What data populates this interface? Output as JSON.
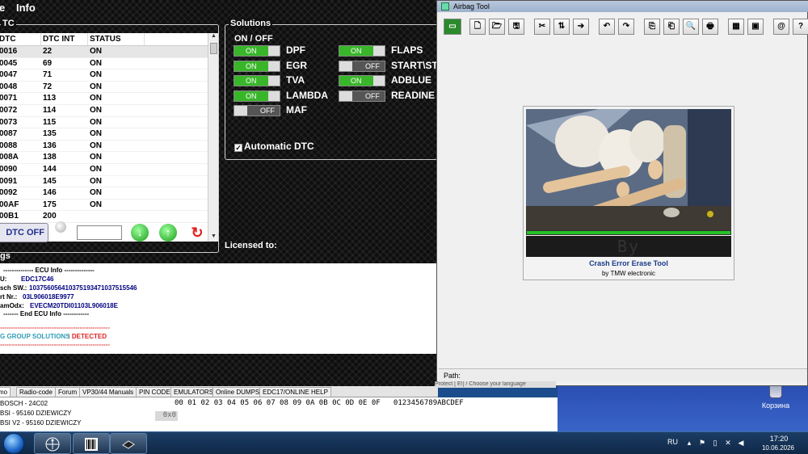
{
  "left_app": {
    "menu": [
      "e",
      "Info"
    ],
    "dtc": {
      "group_title": "TC",
      "headers": [
        "DTC",
        "DTC INT",
        "STATUS"
      ],
      "rows": [
        [
          "0016",
          "22",
          "ON"
        ],
        [
          "0045",
          "69",
          "ON"
        ],
        [
          "0047",
          "71",
          "ON"
        ],
        [
          "0048",
          "72",
          "ON"
        ],
        [
          "0071",
          "113",
          "ON"
        ],
        [
          "0072",
          "114",
          "ON"
        ],
        [
          "0073",
          "115",
          "ON"
        ],
        [
          "0087",
          "135",
          "ON"
        ],
        [
          "0088",
          "136",
          "ON"
        ],
        [
          "008A",
          "138",
          "ON"
        ],
        [
          "0090",
          "144",
          "ON"
        ],
        [
          "0091",
          "145",
          "ON"
        ],
        [
          "0092",
          "146",
          "ON"
        ],
        [
          "00AF",
          "175",
          "ON"
        ],
        [
          "00B1",
          "200",
          ""
        ]
      ]
    },
    "dtc_off_label": "DTC OFF",
    "dtc_input_value": "",
    "solutions": {
      "title": "Solutions",
      "on_off_header": "ON  /  OFF",
      "left": [
        {
          "label": "DPF",
          "state": "ON"
        },
        {
          "label": "EGR",
          "state": "ON"
        },
        {
          "label": "TVA",
          "state": "ON"
        },
        {
          "label": "LAMBDA",
          "state": "ON"
        },
        {
          "label": "MAF",
          "state": "OFF"
        }
      ],
      "right": [
        {
          "label": "FLAPS",
          "state": "ON"
        },
        {
          "label": "START\\ST",
          "state": "OFF"
        },
        {
          "label": "ADBLUE",
          "state": "ON"
        },
        {
          "label": "READINE",
          "state": "OFF"
        }
      ],
      "auto_dtc": "Automatic DTC"
    },
    "licensed_to": "Licensed to:",
    "logs_label": "gs",
    "ecu_log": {
      "header": "-------------- ECU Info --------------",
      "ecu_key": "U:",
      "ecu_val": "EDC17C46",
      "bsw_key": "sch SW.:",
      "bsw_val": "103756056410375193471037515546",
      "part_key": "rt Nr.:",
      "part_val": "03L906018E9977",
      "ramodx_key": "amOdx:",
      "ramodx_val": "EVECM20TDI01103L906018E",
      "footer": "------- End ECU Info ------------",
      "dash1": "---------------------------------------------------",
      "group_key": "G GROUP SOLUTIONS",
      "group_val": ": DETECTED",
      "dash2": "---------------------------------------------------"
    },
    "tabs": [
      "mo",
      "Radio-code",
      "Forum",
      "VP30/44 Manuals",
      "PIN CODE",
      "EMULATORS",
      "Online DUMPS",
      "EDC17/ONLINE HELP"
    ],
    "device_list": [
      "BOSCH - 24C02",
      "BSI - 95160 DZIEWICZY",
      "BSI V2 - 95160 DZIEWICZY"
    ],
    "hex_header": "00 01 02 03 04 05 06 07 08 09 0A 0B 0C 0D 0E 0F   0123456789ABCDEF",
    "hex_addr": "0x0",
    "behind_text": "Protect [ E!] / Choose your language"
  },
  "airbag": {
    "title": "Airbag Tool",
    "toolbar": [
      "calc-icon",
      "new-icon",
      "open-icon",
      "save-icon",
      "cut-icon",
      "transfer-icon",
      "exit-icon",
      "undo-icon",
      "redo-icon",
      "export-icon",
      "import-icon",
      "find-icon",
      "print-icon",
      "calculator-icon",
      "chip-icon",
      "about-icon",
      "help-icon",
      "book-icon"
    ],
    "toolbar_glyphs": [
      "▭",
      "🗋",
      "🗁",
      "🖫",
      "✂",
      "⇅",
      "➔",
      "↶",
      "↷",
      "⎘",
      "⎗",
      "🔍",
      "🖶",
      "▦",
      "▣",
      "@",
      "?",
      "📖"
    ],
    "led_text": "By",
    "media_title": "Crash Error Erase Tool",
    "media_sub": "by TMW electronic",
    "path_label": "Path:",
    "progress": 1.0
  },
  "desktop": {
    "recycle_label": "Корзина"
  },
  "taskbar": {
    "lang": "RU",
    "time": "17:20",
    "date": "10.06.2026"
  }
}
